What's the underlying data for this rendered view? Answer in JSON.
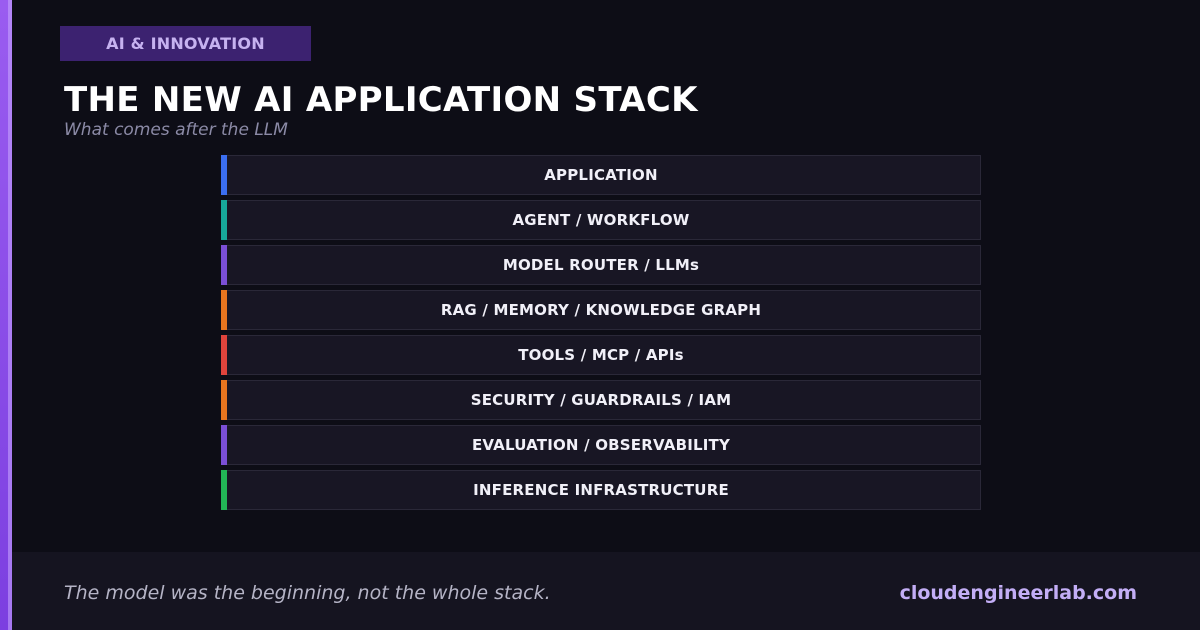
{
  "category": "AI & INNOVATION",
  "title": "THE NEW AI APPLICATION STACK",
  "subtitle": "What comes after the LLM",
  "stack": {
    "layers": [
      {
        "label": "APPLICATION",
        "color": "#3b6ef0"
      },
      {
        "label": "AGENT / WORKFLOW",
        "color": "#17a89a"
      },
      {
        "label": "MODEL ROUTER / LLMs",
        "color": "#7b4fd6"
      },
      {
        "label": "RAG / MEMORY / KNOWLEDGE GRAPH",
        "color": "#e8751f"
      },
      {
        "label": "TOOLS / MCP / APIs",
        "color": "#e0443c"
      },
      {
        "label": "SECURITY / GUARDRAILS / IAM",
        "color": "#e8751f"
      },
      {
        "label": "EVALUATION / OBSERVABILITY",
        "color": "#7b4fd6"
      },
      {
        "label": "INFERENCE INFRASTRUCTURE",
        "color": "#22b556"
      }
    ]
  },
  "footer": {
    "tagline": "The model was the beginning, not the whole stack.",
    "site": "cloudengineerlab.com"
  },
  "colors": {
    "background": "#0d0d16",
    "accent": "#8b4ff0",
    "badge": "#3c2270"
  }
}
